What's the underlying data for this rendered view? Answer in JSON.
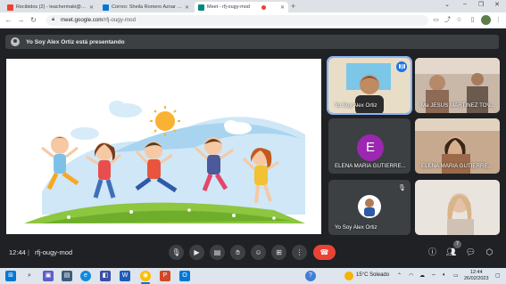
{
  "browser": {
    "tabs": [
      {
        "label": "Recibidos (2) - teachermaki@gm...",
        "favicon_color": "#ea4335",
        "active": false
      },
      {
        "label": "Correo: Sheila Romero Aznar - Ou...",
        "favicon_color": "#0078d4",
        "active": false
      },
      {
        "label": "Meet - rfj-ougy-mod",
        "favicon_color": "#00897b",
        "active": true
      }
    ],
    "url_host": "meet.google.com",
    "url_path": "/rfj-ougy-mod"
  },
  "banner": {
    "text": "Yo Soy Alex Ortiz está presentando"
  },
  "participants": [
    {
      "name": "Yo Soy Alex Ortiz",
      "speaking": true
    },
    {
      "name": "Ma JESUS MARTINEZ TOV..."
    },
    {
      "name": "ELENA MARIA GUTIERRE...",
      "initial": "E",
      "avatar_color": "#9c27b0"
    },
    {
      "name": "ELENA MARIA GUTIERRE..."
    },
    {
      "name": "Yo Soy Alex Ortiz",
      "muted": true
    },
    {
      "name": ""
    }
  ],
  "callbar": {
    "time": "12:44",
    "separator": "|",
    "meeting_code": "rfj-ougy-mod",
    "participant_count": "7",
    "controls": [
      "mic-icon",
      "camera-icon",
      "captions-icon",
      "raise-hand-icon",
      "emoji-icon",
      "present-icon",
      "more-icon",
      "hangup-icon"
    ],
    "right_controls": [
      "info-icon",
      "people-icon",
      "chat-icon",
      "activities-icon"
    ]
  },
  "taskbar": {
    "weather": "15°C  Soleado",
    "time": "12:44",
    "date": "26/02/2023",
    "apps": [
      "windows-icon",
      "search-icon",
      "taskview-icon",
      "edge-icon",
      "explorer-icon",
      "store-icon",
      "word-icon",
      "teams-icon",
      "chrome-icon",
      "powerpoint-icon",
      "outlook-icon"
    ]
  },
  "colors": {
    "meet_background": "#202124",
    "tile_background": "#3c4043",
    "hangup": "#ea4335",
    "speaking_outline": "#8ab4f8",
    "accent": "#1a73e8"
  }
}
